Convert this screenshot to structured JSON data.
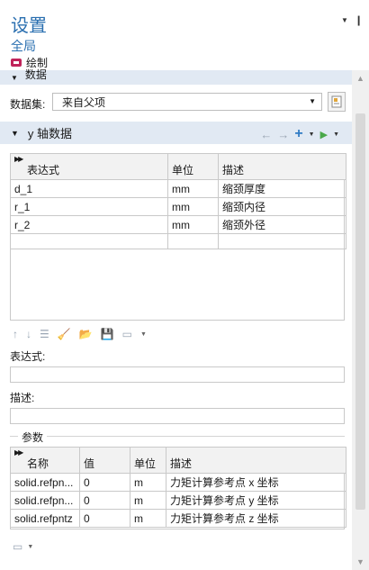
{
  "header": {
    "title": "设置",
    "subtitle": "全局",
    "node_label": "绘制"
  },
  "data_section": {
    "label": "数据",
    "dataset_label": "数据集:",
    "dataset_value": "来自父项"
  },
  "y_section": {
    "label": "y 轴数据",
    "columns": [
      "表达式",
      "单位",
      "描述"
    ],
    "rows": [
      {
        "expr": "d_1",
        "unit": "mm",
        "desc": "缩颈厚度"
      },
      {
        "expr": "r_1",
        "unit": "mm",
        "desc": "缩颈内径"
      },
      {
        "expr": "r_2",
        "unit": "mm",
        "desc": "缩颈外径"
      }
    ]
  },
  "fields": {
    "expression_label": "表达式:",
    "description_label": "描述:"
  },
  "params": {
    "label": "参数",
    "columns": [
      "名称",
      "值",
      "单位",
      "描述"
    ],
    "rows": [
      {
        "name": "solid.refpn...",
        "value": "0",
        "unit": "m",
        "desc": "力矩计算参考点 x 坐标"
      },
      {
        "name": "solid.refpn...",
        "value": "0",
        "unit": "m",
        "desc": "力矩计算参考点 y 坐标"
      },
      {
        "name": "solid.refpntz",
        "value": "0",
        "unit": "m",
        "desc": "力矩计算参考点 z 坐标"
      }
    ]
  }
}
